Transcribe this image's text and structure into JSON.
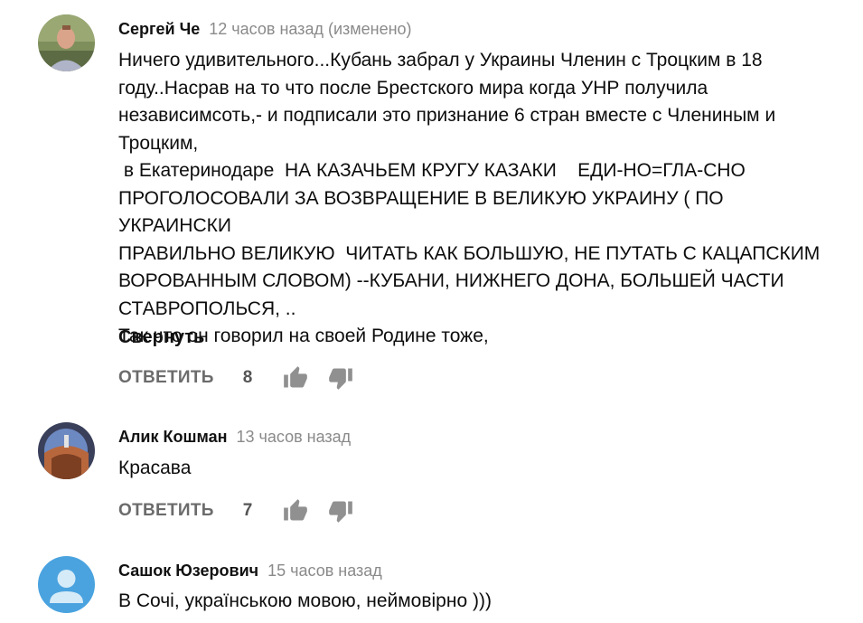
{
  "comments": [
    {
      "author": "Сергей Че",
      "time": "12 часов назад (изменено)",
      "text": "Ничего удивительного...Кубань забрал у Украины Членин с Троцким в 18\nгоду..Насрав на то что после Брестского мира когда УНР получила\nнезависимсоть,- и подписали это признание 6 стран вместе с Члениным и\nТроцким,\n в Екатеринодаре  НА КАЗАЧЬЕМ КРУГУ КАЗАКИ    ЕДИ-НО=ГЛА-СНО\nПРОГОЛОСОВАЛИ ЗА ВОЗВРАЩЕНИЕ В ВЕЛИКУЮ УКРАИНУ ( ПО УКРАИНСКИ\nПРАВИЛЬНО ВЕЛИКУЮ  ЧИТАТЬ КАК БОЛЬШУЮ, НЕ ПУТАТЬ С КАЦАПСКИМ\nВОРОВАННЫМ СЛОВОМ) --КУБАНИ, НИЖНЕГО ДОНА, БОЛЬШЕЙ ЧАСТИ\nСТАВРОПОЛЬСЯ, ..\nТак что он говорил на своей Родине тоже,",
      "collapse_label": "Свернуть",
      "reply_label": "ОТВЕТИТЬ",
      "likes": "8"
    },
    {
      "author": "Алик Кошман",
      "time": "13 часов назад",
      "text": "Красава",
      "reply_label": "ОТВЕТИТЬ",
      "likes": "7"
    },
    {
      "author": "Сашок Юзерович",
      "time": "15 часов назад",
      "text": "В Сочі, українською мовою, неймовірно )))"
    }
  ],
  "icons": {
    "like": "thumb-up-icon",
    "dislike": "thumb-down-icon",
    "default_avatar": "user-silhouette-icon"
  },
  "colors": {
    "author": "#111111",
    "time": "#8a8a8a",
    "action": "#6b6b6b",
    "default_avatar_bg": "#4aa3df"
  }
}
